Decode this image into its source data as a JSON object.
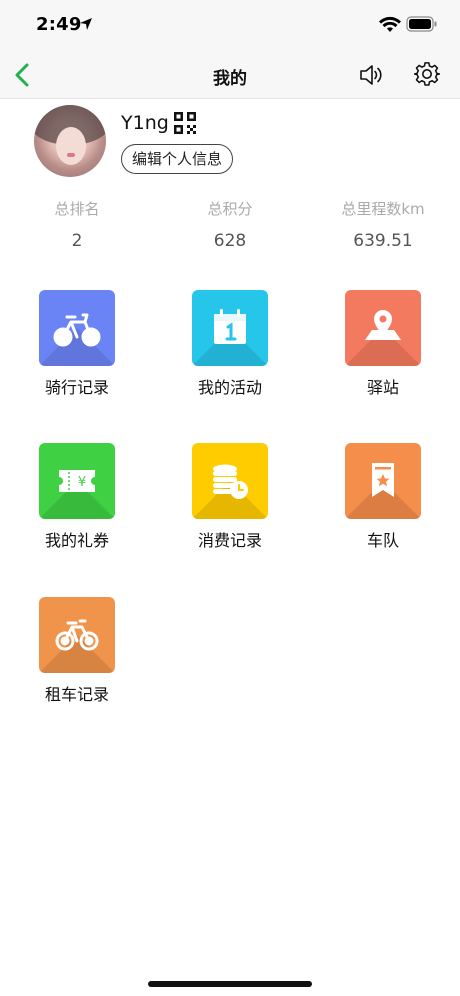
{
  "status": {
    "time": "2:49"
  },
  "nav": {
    "title": "我的"
  },
  "profile": {
    "name": "Y1ng",
    "edit_label": "编辑个人信息"
  },
  "stats": [
    {
      "label": "总排名",
      "value": "2"
    },
    {
      "label": "总积分",
      "value": "628"
    },
    {
      "label": "总里程数km",
      "value": "639.51"
    }
  ],
  "menu": [
    {
      "label": "骑行记录",
      "icon": "bicycle-icon",
      "color": "#6b84f5"
    },
    {
      "label": "我的活动",
      "icon": "calendar-icon",
      "color": "#26c6ea"
    },
    {
      "label": "驿站",
      "icon": "map-pin-icon",
      "color": "#f47a5f"
    },
    {
      "label": "我的礼券",
      "icon": "coupon-icon",
      "color": "#3fd044"
    },
    {
      "label": "消费记录",
      "icon": "coins-clock-icon",
      "color": "#ffcc00"
    },
    {
      "label": "车队",
      "icon": "bookmark-star-icon",
      "color": "#f58d4b"
    },
    {
      "label": "租车记录",
      "icon": "rental-bike-icon",
      "color": "#f0944b"
    }
  ]
}
